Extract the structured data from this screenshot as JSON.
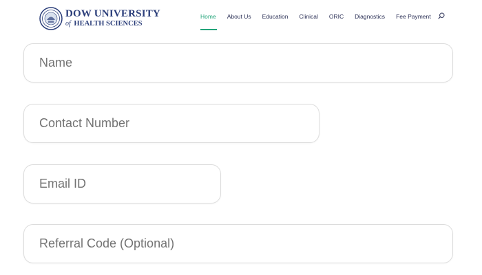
{
  "brand": {
    "line1": "DOW UNIVERSITY",
    "line2_of": "of",
    "line2": "HEALTH SCIENCES",
    "color": "#2b3e7a"
  },
  "nav": {
    "items": [
      {
        "label": "Home",
        "active": true
      },
      {
        "label": "About Us",
        "active": false
      },
      {
        "label": "Education",
        "active": false
      },
      {
        "label": "Clinical",
        "active": false
      },
      {
        "label": "ORIC",
        "active": false
      },
      {
        "label": "Diagnostics",
        "active": false
      },
      {
        "label": "Fee Payment",
        "active": false
      }
    ],
    "search_icon": "search-icon",
    "accent": "#23a47a"
  },
  "form": {
    "name": {
      "placeholder": "Name",
      "value": ""
    },
    "contact": {
      "placeholder": "Contact Number",
      "value": ""
    },
    "email": {
      "placeholder": "Email ID",
      "value": ""
    },
    "referral": {
      "placeholder": "Referral Code (Optional)",
      "value": ""
    }
  }
}
